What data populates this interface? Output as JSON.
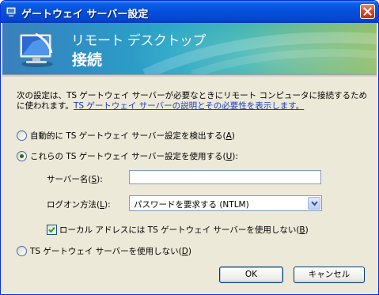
{
  "window": {
    "title": "ゲートウェイ サーバー設定",
    "close_icon": "close-icon"
  },
  "banner": {
    "subtitle": "リモート デスクトップ",
    "title": "接続",
    "icon": "remote-desktop-monitor-icon"
  },
  "description": {
    "text": "次の設定は、TS ゲートウェイ サーバーが必要なときにリモート コンピュータに接続するために使われます。",
    "link": "TS ゲートウェイ サーバーの説明とその必要性を表示します。"
  },
  "options": {
    "auto_detect": {
      "label_pre": "自動的に TS ゲートウェイ サーバー設定を検出する(",
      "key": "A",
      "label_post": ")",
      "selected": false
    },
    "use_settings": {
      "label_pre": "これらの TS ゲートウェイ サーバー設定を使用する(",
      "key": "U",
      "label_post": "):",
      "selected": true
    },
    "no_gateway": {
      "label_pre": "TS ゲートウェイ サーバーを使用しない(",
      "key": "D",
      "label_post": ")",
      "selected": false
    }
  },
  "server_name": {
    "label_pre": "サーバー名(",
    "key": "S",
    "label_post": "):",
    "value": ""
  },
  "logon_method": {
    "label_pre": "ログオン方法(",
    "key": "L",
    "label_post": "):",
    "selected": "パスワードを要求する (NTLM)"
  },
  "bypass_local": {
    "label_pre": "ローカル アドレスには TS ゲートウェイ サーバーを使用しない(",
    "key": "B",
    "label_post": ")",
    "checked": true
  },
  "buttons": {
    "ok": "OK",
    "cancel": "キャンセル"
  },
  "colors": {
    "titlebar": "#0550dc",
    "accent_link": "#1a3dbd",
    "dialog_bg": "#ece9d8"
  }
}
